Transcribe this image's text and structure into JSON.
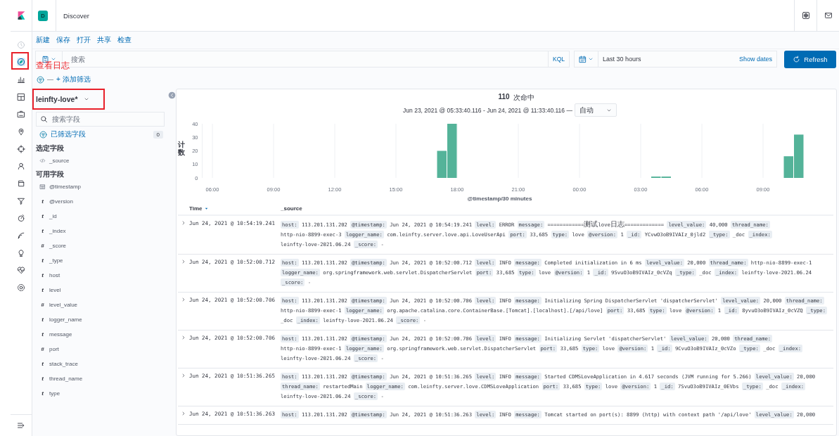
{
  "header": {
    "space_badge": "D",
    "title": "Discover"
  },
  "nav_items": [
    {
      "selected": false,
      "disabled": true,
      "highlighted": false
    },
    {
      "selected": true,
      "disabled": false,
      "highlighted": true
    },
    {
      "selected": false,
      "disabled": false,
      "highlighted": false
    },
    {
      "selected": false,
      "disabled": false,
      "highlighted": false
    },
    {
      "selected": false,
      "disabled": false,
      "highlighted": false
    },
    {
      "selected": false,
      "disabled": false,
      "highlighted": false
    },
    {
      "selected": false,
      "disabled": false,
      "highlighted": false
    },
    {
      "selected": false,
      "disabled": false,
      "highlighted": false
    },
    {
      "selected": false,
      "disabled": false,
      "highlighted": false
    },
    {
      "selected": false,
      "disabled": false,
      "highlighted": false
    },
    {
      "selected": false,
      "disabled": false,
      "highlighted": false
    },
    {
      "selected": false,
      "disabled": false,
      "highlighted": false
    },
    {
      "selected": false,
      "disabled": false,
      "highlighted": false
    },
    {
      "selected": false,
      "disabled": false,
      "highlighted": false
    },
    {
      "selected": false,
      "disabled": false,
      "highlighted": false
    }
  ],
  "top_menu": [
    "新建",
    "保存",
    "打开",
    "共享",
    "检查"
  ],
  "query": {
    "placeholder": "搜索",
    "language": "KQL",
    "time_range": "Last 30 hours",
    "show_dates": "Show dates",
    "refresh": "Refresh"
  },
  "filters": {
    "separator": "—",
    "add_filter": "+ 添加筛选"
  },
  "callout": "查看日志",
  "sidebar": {
    "index_pattern": "leinfty-love*",
    "index_pattern_highlighted": true,
    "search_placeholder": "搜索字段",
    "filtered_fields": "已筛选字段",
    "filtered_count": "0",
    "selected_heading": "选定字段",
    "selected_fields": [
      {
        "kind": "source",
        "name": "_source"
      }
    ],
    "available_heading": "可用字段",
    "available_fields": [
      {
        "kind": "date",
        "name": "@timestamp"
      },
      {
        "kind": "text",
        "glyph": "t",
        "name": "@version"
      },
      {
        "kind": "text",
        "glyph": "t",
        "name": "_id"
      },
      {
        "kind": "text",
        "glyph": "t",
        "name": "_index"
      },
      {
        "kind": "number",
        "glyph": "#",
        "name": "_score"
      },
      {
        "kind": "text",
        "glyph": "t",
        "name": "_type"
      },
      {
        "kind": "text",
        "glyph": "t",
        "name": "host"
      },
      {
        "kind": "text",
        "glyph": "t",
        "name": "level"
      },
      {
        "kind": "number",
        "glyph": "#",
        "name": "level_value"
      },
      {
        "kind": "text",
        "glyph": "t",
        "name": "logger_name"
      },
      {
        "kind": "text",
        "glyph": "t",
        "name": "message"
      },
      {
        "kind": "number",
        "glyph": "#",
        "name": "port"
      },
      {
        "kind": "text",
        "glyph": "t",
        "name": "stack_trace"
      },
      {
        "kind": "text",
        "glyph": "t",
        "name": "thread_name"
      },
      {
        "kind": "text",
        "glyph": "t",
        "name": "type"
      }
    ]
  },
  "results": {
    "hits": "110",
    "hits_label": "次命中",
    "date_range": "Jun 23, 2021 @ 05:33:40.116 - Jun 24, 2021 @ 11:33:40.116 —",
    "interval": "自动",
    "chart_data": {
      "type": "bar",
      "xlabel": "@timestamp/30 minutes",
      "ylabel": "计数",
      "categories": [
        null,
        "06:00",
        null,
        null,
        null,
        null,
        null,
        "09:00",
        null,
        null,
        null,
        null,
        null,
        "12:00",
        null,
        null,
        null,
        null,
        null,
        "15:00",
        null,
        null,
        null,
        null,
        null,
        "18:00",
        null,
        null,
        null,
        null,
        null,
        "21:00",
        null,
        null,
        null,
        null,
        null,
        "00:00",
        null,
        null,
        null,
        null,
        null,
        "03:00",
        null,
        null,
        null,
        null,
        null,
        "06:00",
        null,
        null,
        null,
        null,
        null,
        "09:00",
        null,
        null,
        null,
        null
      ],
      "values": [
        0,
        0,
        0,
        0,
        0,
        0,
        0,
        0,
        0,
        0,
        0,
        0,
        0,
        0,
        0,
        0,
        0,
        0,
        0,
        0,
        0,
        0,
        0,
        20,
        40,
        0,
        0,
        0,
        0,
        0,
        0,
        0,
        0,
        0,
        0,
        0,
        0,
        0,
        0,
        0,
        0,
        0,
        0,
        0,
        1,
        1,
        0,
        0,
        0,
        0,
        0,
        0,
        0,
        0,
        0,
        0,
        0,
        16,
        32,
        0
      ],
      "ylim": [
        0,
        40
      ],
      "yticks": [
        0,
        10,
        20,
        30,
        40
      ],
      "grid": true
    },
    "columns": [
      {
        "label": "Time",
        "sorted": true
      },
      {
        "label": "_source",
        "sorted": false
      }
    ],
    "rows": [
      {
        "expanded": false,
        "time": "Jun 24, 2021 @ 10:54:19.241",
        "fields": [
          {
            "key": "host:",
            "value": "113.201.131.202"
          },
          {
            "key": "@timestamp:",
            "value": "Jun 24, 2021 @ 10:54:19.241"
          },
          {
            "key": "level:",
            "value": "ERROR"
          },
          {
            "key": "message:",
            "value": "============测试love日志============="
          },
          {
            "key": "level_value:",
            "value": "40,000"
          },
          {
            "key": "thread_name:",
            "value": "http-nio-8899-exec-3"
          },
          {
            "key": "logger_name:",
            "value": "com.leinfty.server.love.api.LoveUserApi"
          },
          {
            "key": "port:",
            "value": "33,685"
          },
          {
            "key": "type:",
            "value": "love"
          },
          {
            "key": "@version:",
            "value": "1"
          },
          {
            "key": "_id:",
            "value": "YCvwO3oB9IVAIz_0jld2"
          },
          {
            "key": "_type:",
            "value": "_doc"
          },
          {
            "key": "_index:",
            "value": "leinfty-love-2021.06.24"
          },
          {
            "key": "_score:",
            "value": "-"
          }
        ]
      },
      {
        "expanded": false,
        "time": "Jun 24, 2021 @ 10:52:00.712",
        "fields": [
          {
            "key": "host:",
            "value": "113.201.131.202"
          },
          {
            "key": "@timestamp:",
            "value": "Jun 24, 2021 @ 10:52:00.712"
          },
          {
            "key": "level:",
            "value": "INFO"
          },
          {
            "key": "message:",
            "value": "Completed initialization in 6 ms"
          },
          {
            "key": "level_value:",
            "value": "20,000"
          },
          {
            "key": "thread_name:",
            "value": "http-nio-8899-exec-1"
          },
          {
            "key": "logger_name:",
            "value": "org.springframework.web.servlet.DispatcherServlet"
          },
          {
            "key": "port:",
            "value": "33,685"
          },
          {
            "key": "type:",
            "value": "love"
          },
          {
            "key": "@version:",
            "value": "1"
          },
          {
            "key": "_id:",
            "value": "9SvuO3oB9IVAIz_0cVZq"
          },
          {
            "key": "_type:",
            "value": "_doc"
          },
          {
            "key": "_index:",
            "value": "leinfty-love-2021.06.24"
          },
          {
            "key": "_score:",
            "value": "-"
          }
        ]
      },
      {
        "expanded": false,
        "time": "Jun 24, 2021 @ 10:52:00.706",
        "fields": [
          {
            "key": "host:",
            "value": "113.201.131.202"
          },
          {
            "key": "@timestamp:",
            "value": "Jun 24, 2021 @ 10:52:00.706"
          },
          {
            "key": "level:",
            "value": "INFO"
          },
          {
            "key": "message:",
            "value": "Initializing Spring DispatcherServlet 'dispatcherServlet'"
          },
          {
            "key": "level_value:",
            "value": "20,000"
          },
          {
            "key": "thread_name:",
            "value": "http-nio-8899-exec-1"
          },
          {
            "key": "logger_name:",
            "value": "org.apache.catalina.core.ContainerBase.[Tomcat].[localhost].[/api/love]"
          },
          {
            "key": "port:",
            "value": "33,685"
          },
          {
            "key": "type:",
            "value": "love"
          },
          {
            "key": "@version:",
            "value": "1"
          },
          {
            "key": "_id:",
            "value": "8yvuO3oB9IVAIz_0cVZQ"
          },
          {
            "key": "_type:",
            "value": "_doc"
          },
          {
            "key": "_index:",
            "value": "leinfty-love-2021.06.24"
          },
          {
            "key": "_score:",
            "value": "-"
          }
        ]
      },
      {
        "expanded": false,
        "time": "Jun 24, 2021 @ 10:52:00.706",
        "fields": [
          {
            "key": "host:",
            "value": "113.201.131.202"
          },
          {
            "key": "@timestamp:",
            "value": "Jun 24, 2021 @ 10:52:00.706"
          },
          {
            "key": "level:",
            "value": "INFO"
          },
          {
            "key": "message:",
            "value": "Initializing Servlet 'dispatcherServlet'"
          },
          {
            "key": "level_value:",
            "value": "20,000"
          },
          {
            "key": "thread_name:",
            "value": "http-nio-8899-exec-1"
          },
          {
            "key": "logger_name:",
            "value": "org.springframework.web.servlet.DispatcherServlet"
          },
          {
            "key": "port:",
            "value": "33,685"
          },
          {
            "key": "type:",
            "value": "love"
          },
          {
            "key": "@version:",
            "value": "1"
          },
          {
            "key": "_id:",
            "value": "9CvuO3oB9IVAIz_0cVZo"
          },
          {
            "key": "_type:",
            "value": "_doc"
          },
          {
            "key": "_index:",
            "value": "leinfty-love-2021.06.24"
          },
          {
            "key": "_score:",
            "value": "-"
          }
        ]
      },
      {
        "expanded": false,
        "time": "Jun 24, 2021 @ 10:51:36.265",
        "fields": [
          {
            "key": "host:",
            "value": "113.201.131.202"
          },
          {
            "key": "@timestamp:",
            "value": "Jun 24, 2021 @ 10:51:36.265"
          },
          {
            "key": "level:",
            "value": "INFO"
          },
          {
            "key": "message:",
            "value": "Started CDMSLoveApplication in 4.617 seconds (JVM running for 5.266)"
          },
          {
            "key": "level_value:",
            "value": "20,000"
          },
          {
            "key": "thread_name:",
            "value": "restartedMain"
          },
          {
            "key": "logger_name:",
            "value": "com.leinfty.server.love.CDMSLoveApplication"
          },
          {
            "key": "port:",
            "value": "33,685"
          },
          {
            "key": "type:",
            "value": "love"
          },
          {
            "key": "@version:",
            "value": "1"
          },
          {
            "key": "_id:",
            "value": "7SvuO3oB9IVAIz_0EVbs"
          },
          {
            "key": "_type:",
            "value": "_doc"
          },
          {
            "key": "_index:",
            "value": "leinfty-love-2021.06.24"
          },
          {
            "key": "_score:",
            "value": "-"
          }
        ]
      },
      {
        "expanded": false,
        "time": "Jun 24, 2021 @ 10:51:36.263",
        "fields": [
          {
            "key": "host:",
            "value": "113.201.131.202"
          },
          {
            "key": "@timestamp:",
            "value": "Jun 24, 2021 @ 10:51:36.263"
          },
          {
            "key": "level:",
            "value": "INFO"
          },
          {
            "key": "message:",
            "value": "Tomcat started on port(s): 8899 (http) with context path '/api/love'"
          },
          {
            "key": "level_value:",
            "value": "20,000"
          }
        ]
      }
    ]
  }
}
